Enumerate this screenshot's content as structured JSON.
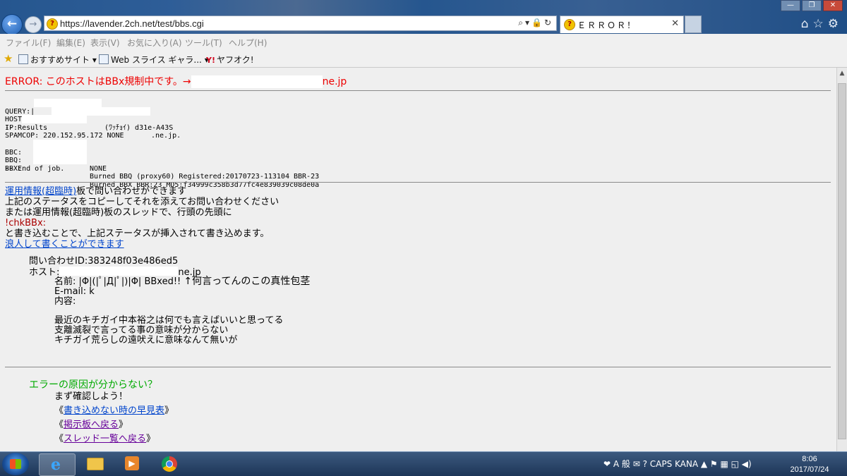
{
  "browser": {
    "url": "https://lavender.2ch.net/test/bbs.cgi",
    "tab_title": "ＥＲＲＯＲ！",
    "menu": [
      "ファイル(F)",
      "編集(E)",
      "表示(V)",
      "お気に入り(A)",
      "ツール(T)",
      "ヘルプ(H)"
    ],
    "favorites": [
      "おすすめサイト ▾",
      "Web スライス ギャラ... ▾",
      "ヤフオク!"
    ]
  },
  "page": {
    "error_prefix": "ERROR: このホストはBBx規制中です。→",
    "error_suffix": "ne.jp",
    "diag": {
      "query_label": "QUERY:|",
      "query_value": "(ﾜｯﾁｮｲ) d31e-A43S",
      "hostname_label": "HOST NAME:",
      "hostname_value": ".ne.jp.",
      "ip_label": "IP:",
      "results": "-- Results",
      "spamcop": "SPAMCOP: 220.152.95.172 NONE",
      "bbc_label": "BBC:",
      "bbc_value": "NONE",
      "bbq_label": "BBQ:",
      "bbq_value": "Burned BBQ (proxy60) Registered:20170723-113104 BBR-23",
      "bbx_label": "BBX:",
      "bbx_value": "Burned BBX BBR:23 MD5:f34999c358b3d77fc4e839039c08de0a",
      "end": "-- End of job."
    },
    "help": {
      "link_ops": "運用情報(超臨時)",
      "line1_rest": "板で問い合わせができます",
      "line2": "上記のステータスをコピーしてそれを添えてお問い合わせください",
      "line3": "または運用情報(超臨時)板のスレッドで、行頭の先頭に",
      "command": "!chkBBx:",
      "line4": "と書き込むことで、上記ステータスが挿入されて書き込めます。",
      "link_ronin": "浪人して書くことができます"
    },
    "inquiry": {
      "id_line": "問い合わせID:383248f03e486ed5",
      "host_label": "ホスト:",
      "host_suffix": "ne.jp"
    },
    "post": {
      "name_line": "名前: |Φ|(|ﾟ|Д|ﾟ|)|Φ| BBxed!!",
      "annotation": "↑何言ってんのこの真性包茎",
      "email_line": "E-mail: k",
      "content_label": "内容:",
      "body": [
        "最近のキチガイ中本裕之は何でも言えばいいと思ってる",
        "支離滅裂で言ってる事の意味が分からない",
        "キチガイ荒らしの遠吠えに意味なんて無いが"
      ]
    },
    "cause_title": "エラーの原因が分からない？",
    "check_first": "まず確認しよう！",
    "links": {
      "open": "《",
      "close": "》",
      "cannot_post": "書き込めない時の早見表",
      "back_board": "掲示板へ戻る",
      "thread_list": "スレッド一覧へ戻る"
    }
  },
  "taskbar": {
    "tray": "❤ A 般 ✉ ? CAPS KANA ▲ ⚑ ▦ ◱ ◀)",
    "time": "8:06",
    "date": "2017/07/24"
  },
  "colors": {
    "error_red": "#ee0000",
    "link_blue": "#0044cc",
    "visited_purple": "#660099",
    "cause_green": "#00aa00",
    "command_darkred": "#aa0000"
  },
  "icons": [
    "back-icon",
    "forward-icon",
    "favicon",
    "search-icon",
    "lock-icon",
    "refresh-icon",
    "home-icon",
    "star-icon",
    "gear-icon",
    "ie-icon",
    "folder-icon",
    "media-icon",
    "chrome-icon"
  ]
}
